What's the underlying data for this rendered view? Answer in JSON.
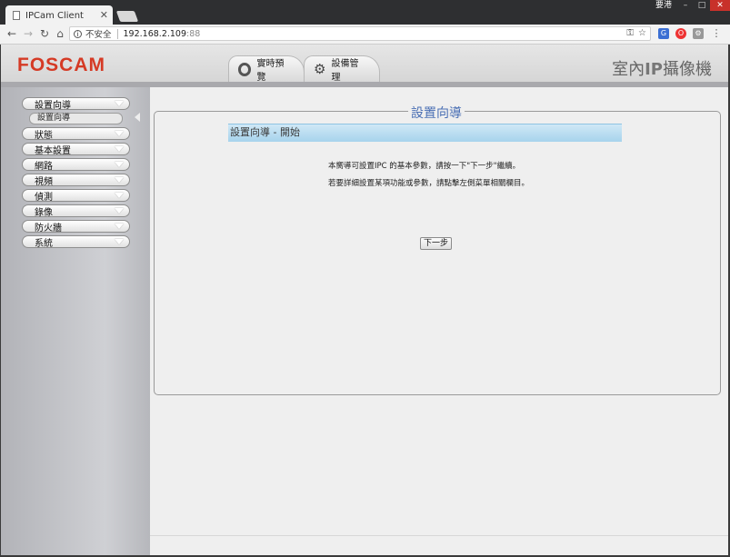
{
  "browser": {
    "tab_title": "IPCam Client",
    "tab_close": "✕",
    "user_name": "要港",
    "win_min": "–",
    "win_max": "□",
    "win_close": "✕",
    "security_label": "不安全",
    "url_host": "192.168.2.109",
    "url_port": ":88"
  },
  "header": {
    "logo": "FOSCAM",
    "tabs": [
      {
        "label": "實時預覽"
      },
      {
        "label": "設備管理"
      }
    ],
    "title_part1": "室內",
    "title_part2": "IP",
    "title_part3": "攝像機"
  },
  "sidebar": {
    "items": [
      {
        "label": "設置向導"
      },
      {
        "label": "狀態"
      },
      {
        "label": "基本設置"
      },
      {
        "label": "網路"
      },
      {
        "label": "視頻"
      },
      {
        "label": "偵測"
      },
      {
        "label": "錄像"
      },
      {
        "label": "防火牆"
      },
      {
        "label": "系統"
      }
    ],
    "sub_item": "設置向導"
  },
  "main": {
    "legend": "設置向導",
    "section_title": "設置向導 - 開始",
    "desc1": "本嚮導可設置IPC 的基本參數，請按一下\"下一步\"繼續。",
    "desc2": "若要詳細設置某項功能或參數，請點擊左側菜單相關欄目。",
    "next_button": "下一步"
  }
}
